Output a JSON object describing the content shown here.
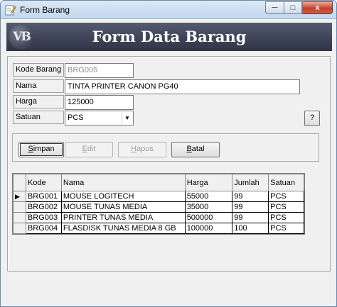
{
  "window": {
    "title": "Form Barang",
    "icon": "edit-form-icon"
  },
  "caption": {
    "minimize": "─",
    "maximize": "□",
    "close": "x"
  },
  "banner": {
    "logo": "VB",
    "title": "Form Data Barang"
  },
  "form": {
    "kode_label": "Kode Barang",
    "kode_value": "BRG005",
    "nama_label": "Nama",
    "nama_value": "TINTA PRINTER CANON PG40",
    "harga_label": "Harga",
    "harga_value": "125000",
    "satuan_label": "Satuan",
    "satuan_value": "PCS",
    "help_label": "?"
  },
  "buttons": {
    "simpan": {
      "first": "S",
      "rest": "impan"
    },
    "edit": {
      "first": "E",
      "rest": "dit"
    },
    "hapus": {
      "first": "H",
      "rest": "apus"
    },
    "batal": {
      "first": "B",
      "rest": "atal"
    }
  },
  "grid": {
    "columns": [
      "Kode",
      "Nama",
      "Harga",
      "Jumlah",
      "Satuan"
    ],
    "current_row_marker": "▶",
    "rows": [
      [
        "BRG001",
        "MOUSE LOGITECH",
        "55000",
        "99",
        "PCS"
      ],
      [
        "BRG002",
        "MOUSE TUNAS MEDIA",
        "35000",
        "99",
        "PCS"
      ],
      [
        "BRG003",
        "PRINTER TUNAS MEDIA",
        "500000",
        "99",
        "PCS"
      ],
      [
        "BRG004",
        "FLASDISK TUNAS MEDIA 8 GB",
        "100000",
        "100",
        "PCS"
      ]
    ]
  }
}
